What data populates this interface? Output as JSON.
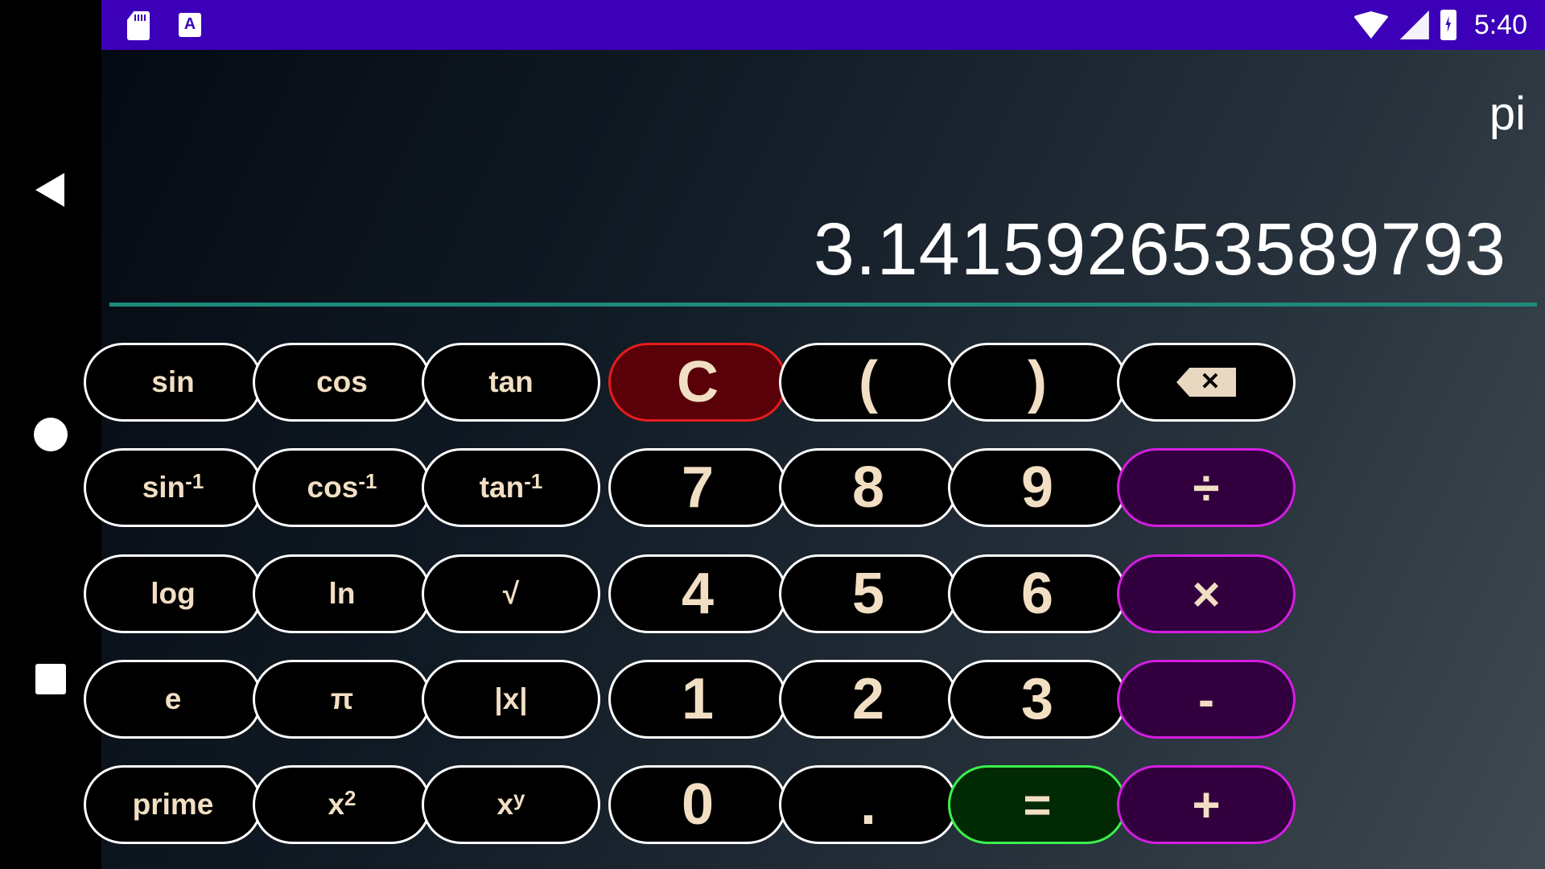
{
  "status_bar": {
    "time": "5:40",
    "left_icons": [
      "sd-card-icon",
      "font-a-icon"
    ],
    "right_icons": [
      "wifi-icon",
      "cell-signal-icon",
      "battery-charging-icon"
    ],
    "a_glyph": "A",
    "color": "#3b00b8"
  },
  "nav_bar": {
    "buttons": [
      "back-icon",
      "home-icon",
      "recents-icon"
    ]
  },
  "display": {
    "expression": "pi",
    "result": "3.141592653589793",
    "divider_color": "#1e8a7a"
  },
  "keys": {
    "sin": "sin",
    "cos": "cos",
    "tan": "tan",
    "clear": "C",
    "open_paren": "(",
    "close_paren": ")",
    "backspace_symbol": "✕",
    "asin_base": "sin",
    "acos_base": "cos",
    "atan_base": "tan",
    "inverse_exp": "-1",
    "seven": "7",
    "eight": "8",
    "nine": "9",
    "divide": "÷",
    "log": "log",
    "ln": "ln",
    "sqrt": "√",
    "four": "4",
    "five": "5",
    "six": "6",
    "multiply": "×",
    "e": "e",
    "pi": "π",
    "abs": "|x|",
    "one": "1",
    "two": "2",
    "three": "3",
    "minus": "-",
    "prime": "prime",
    "square_base": "x",
    "square_exp": "2",
    "power_base": "x",
    "power_exp": "y",
    "zero": "0",
    "dot": ".",
    "equals": "=",
    "plus": "+"
  },
  "colors": {
    "key_text": "#f2dfc3",
    "clear_bg": "#5a0008",
    "clear_border": "#e61c1c",
    "operator_bg": "#32003e",
    "operator_border": "#d41ee0",
    "equals_bg": "#012a04",
    "equals_border": "#3cf04c"
  }
}
